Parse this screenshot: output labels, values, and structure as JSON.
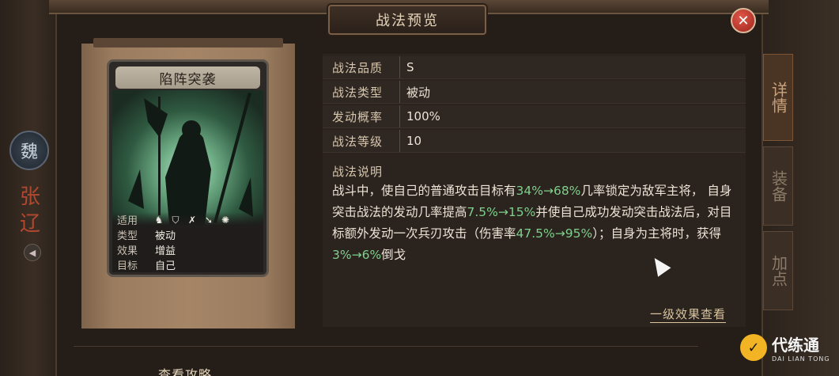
{
  "dialog": {
    "title": "战法预览"
  },
  "side": {
    "faction": "魏",
    "hero_chars": [
      "张",
      "辽"
    ],
    "tabs": [
      {
        "label": "详情",
        "active": true
      },
      {
        "label": "装备",
        "active": false
      },
      {
        "label": "加点",
        "active": false
      }
    ]
  },
  "card": {
    "name": "陷阵突袭",
    "rows": [
      {
        "key": "适用",
        "icons": [
          "cavalry-icon",
          "shield-icon",
          "bow-icon",
          "spear-icon",
          "siege-icon"
        ]
      },
      {
        "key": "类型",
        "value": "被动"
      },
      {
        "key": "效果",
        "value": "增益"
      },
      {
        "key": "目标",
        "value": "自己"
      }
    ]
  },
  "props": [
    {
      "key": "战法品质",
      "value": "S"
    },
    {
      "key": "战法类型",
      "value": "被动"
    },
    {
      "key": "发动概率",
      "value": "100%"
    },
    {
      "key": "战法等级",
      "value": "10"
    }
  ],
  "description": {
    "heading": "战法说明",
    "segments": [
      {
        "text": "战斗中，使自己的普通攻击目标有",
        "hl": false
      },
      {
        "text": "34%→68%",
        "hl": true
      },
      {
        "text": "几率锁定为敌军主将，  自身突击战法的发动几率提高",
        "hl": false
      },
      {
        "text": "7.5%→15%",
        "hl": true
      },
      {
        "text": "并使自己成功发动突击战法后，对目标额外发动一次兵刃攻击（伤害率",
        "hl": false
      },
      {
        "text": "47.5%→95%",
        "hl": true
      },
      {
        "text": "）；自身为主将时，获得",
        "hl": false
      },
      {
        "text": "3%→6%",
        "hl": true
      },
      {
        "text": "倒戈",
        "hl": false
      }
    ]
  },
  "links": {
    "level_effect": "一级效果查看",
    "guide": "查看攻略"
  },
  "watermark": {
    "title": "代练通",
    "subtitle": "DAI LIAN TONG"
  },
  "colors": {
    "highlight": "#7fd08c",
    "accent": "#d9c49d",
    "close": "#c0392b"
  }
}
